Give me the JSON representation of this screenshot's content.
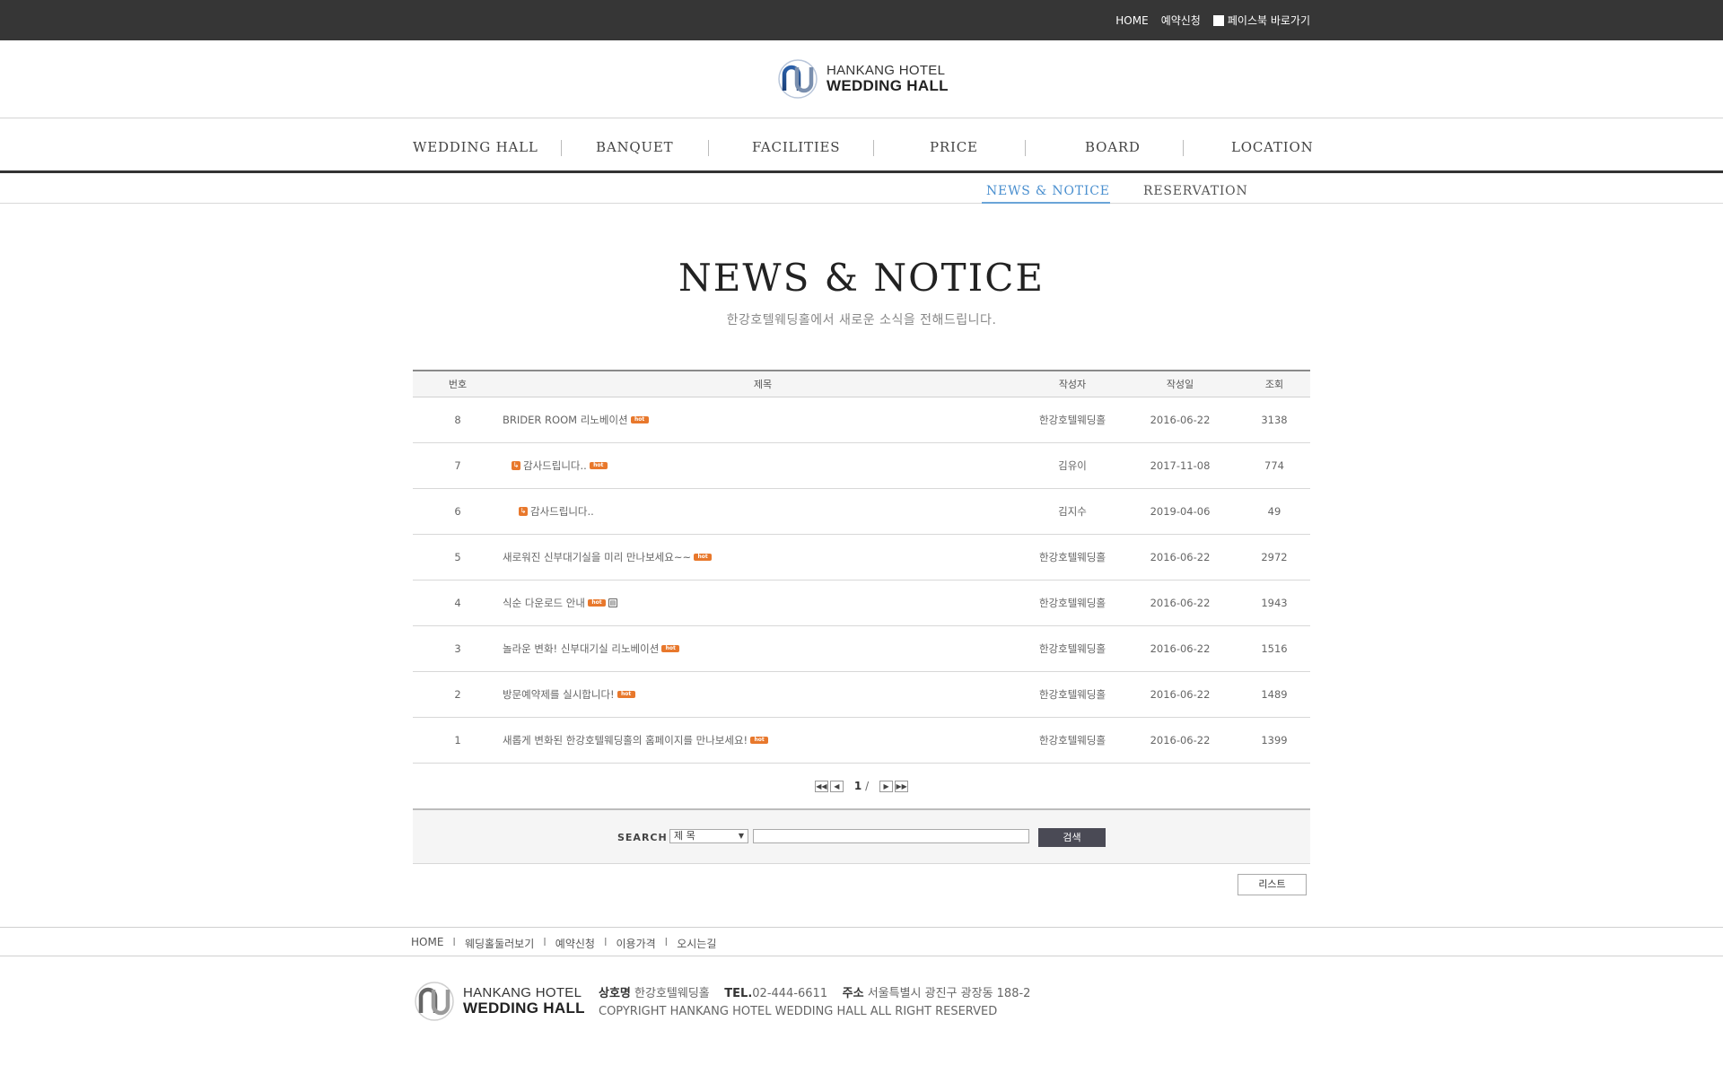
{
  "topbar": {
    "home": "HOME",
    "reservation": "예약신청",
    "facebook": "페이스북 바로가기"
  },
  "logo": {
    "line1": "HANKANG HOTEL",
    "line2": "WEDDING HALL"
  },
  "main_nav": [
    "WEDDING HALL",
    "BANQUET",
    "FACILITIES",
    "PRICE",
    "BOARD",
    "LOCATION"
  ],
  "sub_nav": {
    "news": "NEWS & NOTICE",
    "reservation": "RESERVATION"
  },
  "page": {
    "title": "NEWS & NOTICE",
    "subtitle": "한강호텔웨딩홀에서 새로운 소식을 전해드립니다."
  },
  "table": {
    "headers": {
      "num": "번호",
      "title": "제목",
      "author": "작성자",
      "date": "작성일",
      "views": "조회"
    },
    "rows": [
      {
        "num": "8",
        "title": "BRIDER ROOM 리노베이션",
        "author": "한강호텔웨딩홀",
        "date": "2016-06-22",
        "views": "3138"
      },
      {
        "num": "7",
        "title": "감사드립니다..",
        "author": "김유이",
        "date": "2017-11-08",
        "views": "774"
      },
      {
        "num": "6",
        "title": "감사드립니다..",
        "author": "김지수",
        "date": "2019-04-06",
        "views": "49"
      },
      {
        "num": "5",
        "title": "새로워진 신부대기실을 미리 만나보세요~~",
        "author": "한강호텔웨딩홀",
        "date": "2016-06-22",
        "views": "2972"
      },
      {
        "num": "4",
        "title": "식순 다운로드 안내",
        "author": "한강호텔웨딩홀",
        "date": "2016-06-22",
        "views": "1943"
      },
      {
        "num": "3",
        "title": "놀라운 변화! 신부대기실 리노베이션",
        "author": "한강호텔웨딩홀",
        "date": "2016-06-22",
        "views": "1516"
      },
      {
        "num": "2",
        "title": "방문예약제를 실시합니다!",
        "author": "한강호텔웨딩홀",
        "date": "2016-06-22",
        "views": "1489"
      },
      {
        "num": "1",
        "title": "새롭게 변화된 한강호텔웨딩홀의 홈페이지를 만나보세요!",
        "author": "한강호텔웨딩홀",
        "date": "2016-06-22",
        "views": "1399"
      }
    ],
    "hot_badge": "hot",
    "reply_icon": "reply-icon",
    "file_icon": "file-icon"
  },
  "pager": {
    "current": "1",
    "suffix": "/"
  },
  "search": {
    "label": "SEARCH",
    "select_value": "제 목",
    "button": "검색"
  },
  "list_button": "리스트",
  "footer": {
    "nav": [
      "HOME",
      "웨딩홀둘러보기",
      "예약신청",
      "이용가격",
      "오시는길"
    ],
    "sep": "I",
    "company_label": "상호명",
    "company": "한강호텔웨딩홀",
    "tel_label": "TEL.",
    "tel": "02-444-6611",
    "addr_label": "주소",
    "addr": "서울특별시 광진구 광장동 188-2",
    "copyright": "COPYRIGHT HANKANG HOTEL WEDDING HALL ALL RIGHT RESERVED"
  },
  "colors": {
    "topbar": "#363636",
    "accent": "#4a8fcf",
    "hot": "#e8782c",
    "search_button": "#4a4a55"
  }
}
